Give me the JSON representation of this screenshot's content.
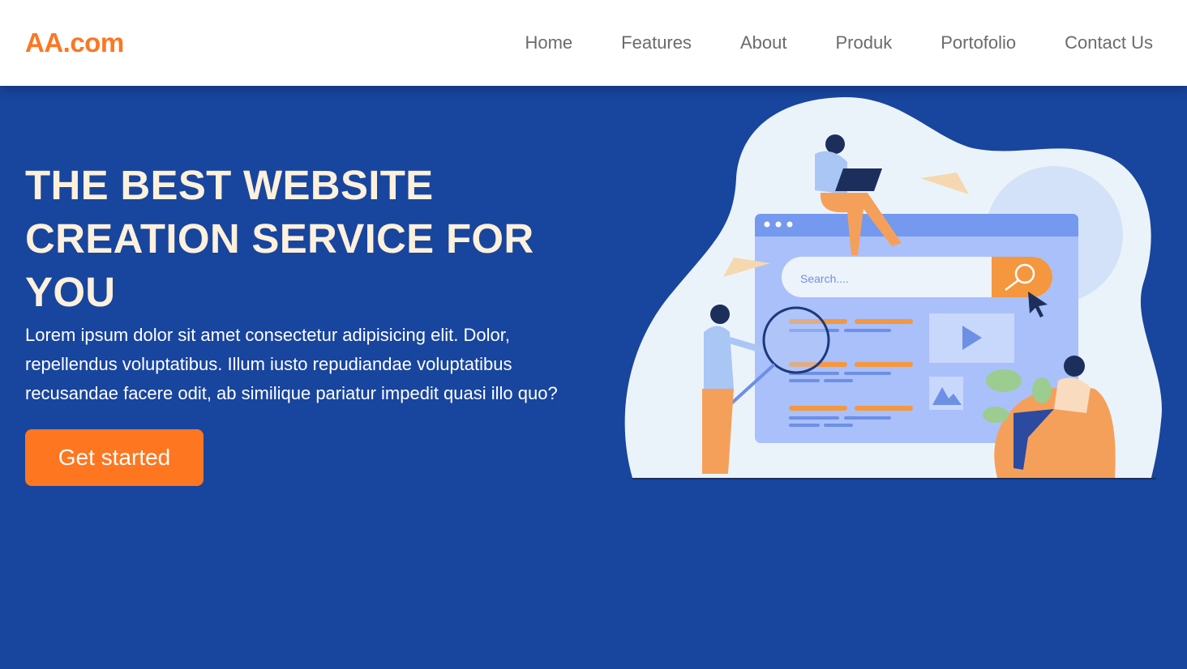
{
  "header": {
    "logo": "AA.com",
    "nav": [
      "Home",
      "Features",
      "About",
      "Produk",
      "Portofolio",
      "Contact Us"
    ]
  },
  "hero": {
    "title": "THE BEST WEBSITE CREATION SERVICE FOR YOU",
    "description": "Lorem ipsum dolor sit amet consectetur adipisicing elit. Dolor, repellendus voluptatibus. Illum iusto repudiandae voluptatibus recusandae facere odit, ab similique pariatur impedit quasi illo quo?",
    "cta": "Get started"
  },
  "illustration": {
    "search_placeholder": "Search...."
  },
  "colors": {
    "brand": "#fd7622",
    "background": "#18459e",
    "title": "#fdf1dc"
  }
}
